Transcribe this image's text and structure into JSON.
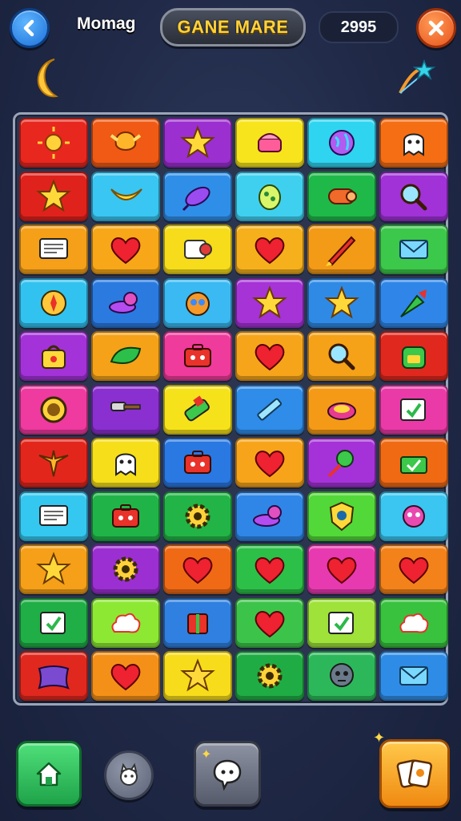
{
  "header": {
    "player_name": "Momag",
    "title": "GANE MARE",
    "score": "2995"
  },
  "icons": {
    "back": "arrow-left-icon",
    "close": "close-icon",
    "moon": "crescent-moon-icon",
    "bow": "bow-and-star-icon"
  },
  "board": {
    "columns": 6,
    "rows": 11,
    "tiles": [
      {
        "color": "#e8271f",
        "icon": "sun"
      },
      {
        "color": "#f05a14",
        "icon": "phoenix"
      },
      {
        "color": "#9b2fd0",
        "icon": "star"
      },
      {
        "color": "#f7e41c",
        "icon": "cake"
      },
      {
        "color": "#2fd4f0",
        "icon": "globe"
      },
      {
        "color": "#f56e14",
        "icon": "ghost"
      },
      {
        "color": "#e0221c",
        "icon": "star"
      },
      {
        "color": "#39c6f2",
        "icon": "banana"
      },
      {
        "color": "#2f8fe8",
        "icon": "plane"
      },
      {
        "color": "#3fd0f0",
        "icon": "turtle"
      },
      {
        "color": "#1fb94a",
        "icon": "log"
      },
      {
        "color": "#a032d8",
        "icon": "magnifier"
      },
      {
        "color": "#f5a018",
        "icon": "monitor"
      },
      {
        "color": "#f7a718",
        "icon": "heart"
      },
      {
        "color": "#f6dc1a",
        "icon": "paper-roll"
      },
      {
        "color": "#f5b01c",
        "icon": "heart"
      },
      {
        "color": "#f39a16",
        "icon": "rocket"
      },
      {
        "color": "#3cc84a",
        "icon": "envelope"
      },
      {
        "color": "#32c2f0",
        "icon": "compass"
      },
      {
        "color": "#2a7ae0",
        "icon": "snail"
      },
      {
        "color": "#3ab9f2",
        "icon": "monster"
      },
      {
        "color": "#a533d6",
        "icon": "star"
      },
      {
        "color": "#2f8ae6",
        "icon": "star"
      },
      {
        "color": "#2f86e8",
        "icon": "carrot"
      },
      {
        "color": "#a332d8",
        "icon": "bag"
      },
      {
        "color": "#f5a218",
        "icon": "leaf"
      },
      {
        "color": "#ef3b9b",
        "icon": "toolbox"
      },
      {
        "color": "#f6a51a",
        "icon": "heart"
      },
      {
        "color": "#f5a218",
        "icon": "magnifier"
      },
      {
        "color": "#e0281e",
        "icon": "backpack"
      },
      {
        "color": "#ef3aa0",
        "icon": "coin"
      },
      {
        "color": "#8a2fd0",
        "icon": "hammer"
      },
      {
        "color": "#f6e21a",
        "icon": "battery"
      },
      {
        "color": "#2f8ce8",
        "icon": "pencil"
      },
      {
        "color": "#f59a16",
        "icon": "soap"
      },
      {
        "color": "#ea3aa8",
        "icon": "book"
      },
      {
        "color": "#e3261c",
        "icon": "bird"
      },
      {
        "color": "#f6df1a",
        "icon": "ghost"
      },
      {
        "color": "#2a78e2",
        "icon": "toolbox"
      },
      {
        "color": "#f7a41a",
        "icon": "heart"
      },
      {
        "color": "#a532d8",
        "icon": "lollipop"
      },
      {
        "color": "#f06a14",
        "icon": "basket"
      },
      {
        "color": "#34c8f0",
        "icon": "monitor"
      },
      {
        "color": "#20b448",
        "icon": "toolbox"
      },
      {
        "color": "#22b446",
        "icon": "gear"
      },
      {
        "color": "#2f86e6",
        "icon": "snail"
      },
      {
        "color": "#52d838",
        "icon": "shield"
      },
      {
        "color": "#3ac6f0",
        "icon": "creature"
      },
      {
        "color": "#f5a018",
        "icon": "star"
      },
      {
        "color": "#9b2fd2",
        "icon": "gear"
      },
      {
        "color": "#f06a16",
        "icon": "heart"
      },
      {
        "color": "#2cc048",
        "icon": "heart"
      },
      {
        "color": "#e83ab0",
        "icon": "heart"
      },
      {
        "color": "#f3821a",
        "icon": "heart"
      },
      {
        "color": "#20ae46",
        "icon": "book"
      },
      {
        "color": "#8de834",
        "icon": "cloud"
      },
      {
        "color": "#2f80e0",
        "icon": "gift"
      },
      {
        "color": "#3cc44a",
        "icon": "heart"
      },
      {
        "color": "#9ee23a",
        "icon": "book"
      },
      {
        "color": "#38c23e",
        "icon": "cloud"
      },
      {
        "color": "#e0281e",
        "icon": "pillow"
      },
      {
        "color": "#f49018",
        "icon": "heart"
      },
      {
        "color": "#f6dc1a",
        "icon": "star"
      },
      {
        "color": "#20ac44",
        "icon": "gear"
      },
      {
        "color": "#2cb85a",
        "icon": "alien"
      },
      {
        "color": "#2f8ce6",
        "icon": "envelope"
      }
    ]
  },
  "footer": {
    "home": "home-icon",
    "pet": "pet-icon",
    "chat": "chat-bubble-icon",
    "cards": "cards-icon"
  }
}
